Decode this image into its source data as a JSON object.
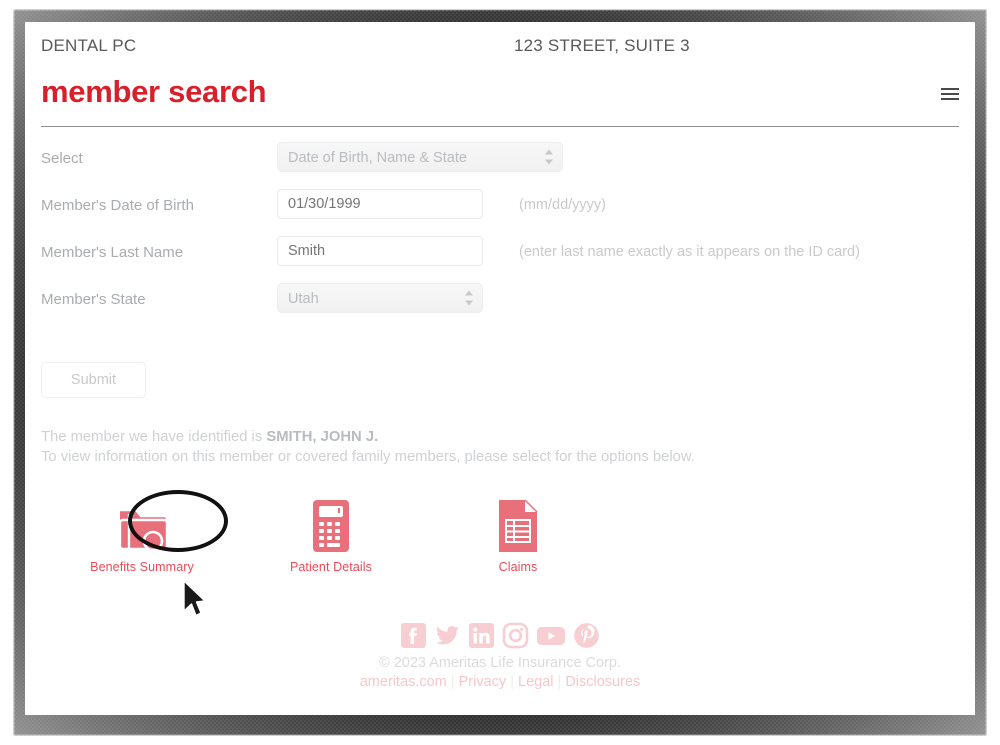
{
  "header": {
    "practice_name": "DENTAL PC",
    "practice_address": "123 STREET, SUITE 3",
    "page_title": "member search",
    "menu_icon": "hamburger-menu-icon"
  },
  "form": {
    "rows": [
      {
        "label": "Select",
        "control": "select",
        "value": "Date of Birth, Name & State",
        "hint": ""
      },
      {
        "label": "Member's Date of Birth",
        "control": "input",
        "value": "01/30/1999",
        "hint": "(mm/dd/yyyy)"
      },
      {
        "label": "Member's Last Name",
        "control": "input",
        "value": "Smith",
        "hint": "(enter last name exactly as it appears on the ID card)"
      },
      {
        "label": "Member's State",
        "control": "select",
        "value": "Utah",
        "hint": ""
      }
    ],
    "submit_label": "Submit"
  },
  "result": {
    "line1_prefix": "The member we have identified is ",
    "member_name": "SMITH, JOHN J.",
    "line2": "To view information on this member or covered family members, please select for the options below."
  },
  "options": [
    {
      "label": "Benefits Summary",
      "icon": "folder-search-icon",
      "annotated": true
    },
    {
      "label": "Patient Details",
      "icon": "calculator-icon",
      "annotated": false
    },
    {
      "label": "Claims",
      "icon": "document-table-icon",
      "annotated": false
    }
  ],
  "footer": {
    "social": [
      {
        "name": "facebook-icon"
      },
      {
        "name": "twitter-icon"
      },
      {
        "name": "linkedin-icon"
      },
      {
        "name": "instagram-icon"
      },
      {
        "name": "youtube-icon"
      },
      {
        "name": "pinterest-icon"
      }
    ],
    "copyright": "© 2023 Ameritas Life Insurance Corp.",
    "links": [
      "ameritas.com",
      "Privacy",
      "Legal",
      "Disclosures"
    ],
    "separator": "|"
  },
  "colors": {
    "brand_red": "#d81f2a",
    "icon_red": "#e8707b",
    "label_gray": "#a9acaf",
    "social_pink": "#f7ced2"
  }
}
